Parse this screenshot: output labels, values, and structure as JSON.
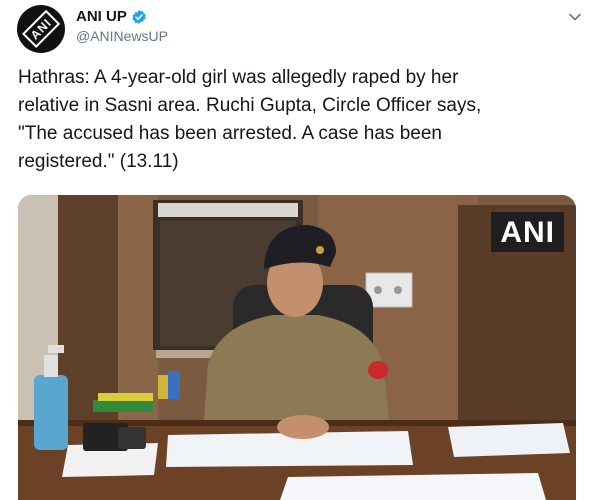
{
  "account": {
    "display_name": "ANI UP",
    "handle": "@ANINewsUP",
    "avatar_text": "ANI"
  },
  "tweet": {
    "text": "Hathras: A 4-year-old girl was allegedly raped by her\nrelative in Sasni area. Ruchi Gupta, Circle Officer says,\n\"The accused has been arrested. A case has been\nregistered.\" (13.11)"
  },
  "media": {
    "watermark": "ANI"
  },
  "icons": {
    "verified": "verified-badge-icon",
    "caret": "chevron-down-icon"
  },
  "colors": {
    "verified_blue": "#1da1f2",
    "handle_gray": "#657786"
  }
}
